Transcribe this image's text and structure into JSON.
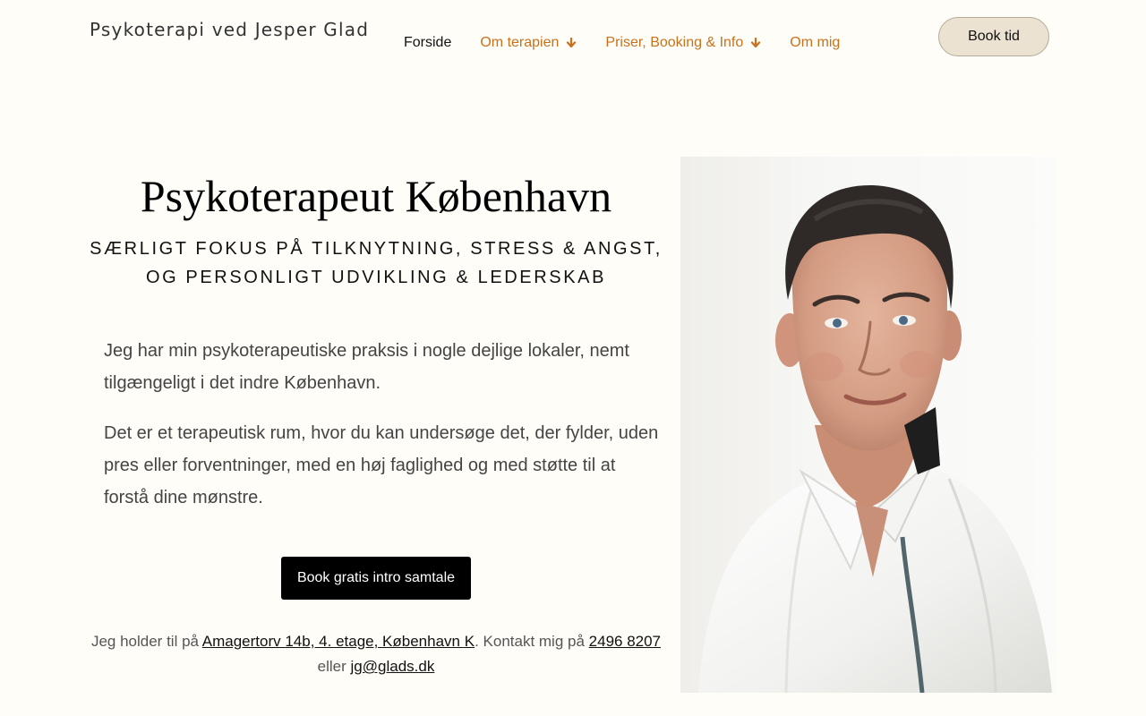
{
  "header": {
    "site_title": "Psykoterapi ved Jesper Glad",
    "nav": [
      {
        "label": "Forside",
        "active": true,
        "dropdown": false
      },
      {
        "label": "Om terapien",
        "active": false,
        "dropdown": true
      },
      {
        "label": "Priser, Booking & Info",
        "active": false,
        "dropdown": true
      },
      {
        "label": "Om mig",
        "active": false,
        "dropdown": false
      }
    ],
    "book_button": "Book tid"
  },
  "hero": {
    "title": "Psykoterapeut København",
    "subtitle_line1": "SÆRLIGT FOKUS PÅ TILKNYTNING, STRESS & ANGST,",
    "subtitle_line2": "OG PERSONLIGT UDVIKLING & LEDERSKAB",
    "paragraph1": "Jeg har min psykoterapeutiske praksis i nogle dejlige lokaler, nemt tilgængeligt i det indre København.",
    "paragraph2": "Det er et terapeutisk rum, hvor du kan undersøge det, der fylder, uden pres eller forventninger, med en høj faglighed og med støtte til at forstå dine mønstre.",
    "cta_button": "Book gratis intro samtale",
    "contact": {
      "prefix": "Jeg holder til på ",
      "address": "Amagertorv 14b, 4. etage, København K",
      "middle": ". Kontakt mig på ",
      "phone": "2496 8207",
      "or": " eller ",
      "email": "jg@glads.dk"
    }
  },
  "colors": {
    "background": "#fffdf8",
    "nav_link": "#c9711c",
    "book_button_bg": "#ebe2d2",
    "cta_bg": "#000000"
  },
  "icons": {
    "dropdown": "arrow-down-icon"
  }
}
